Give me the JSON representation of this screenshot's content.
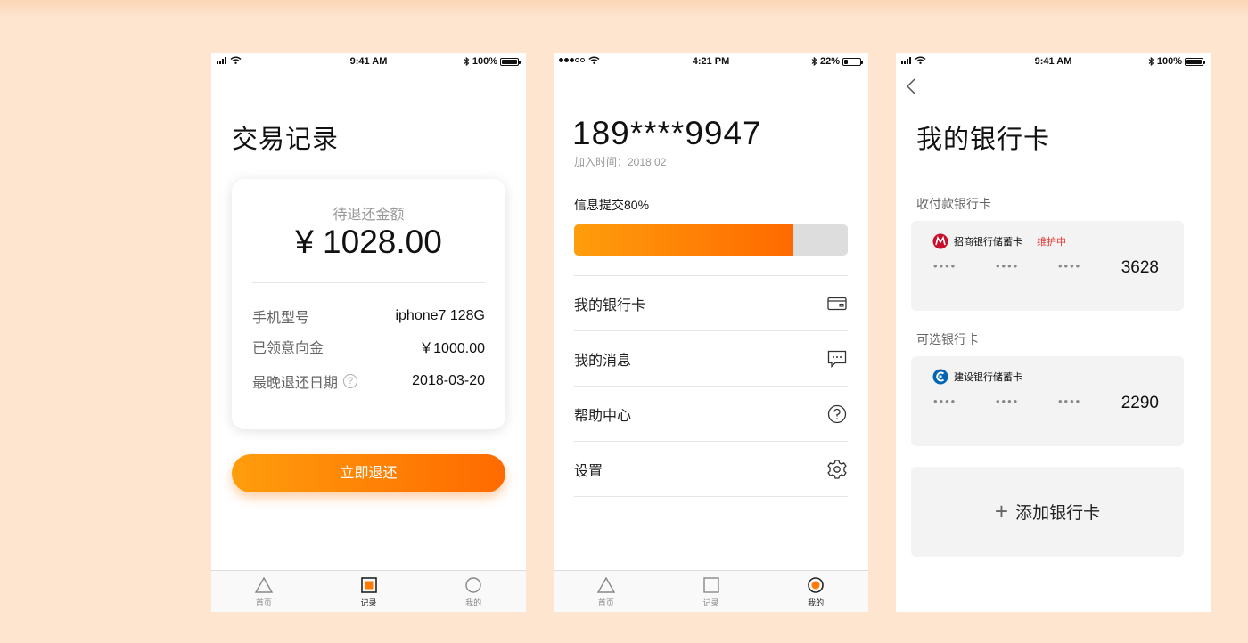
{
  "screen1": {
    "status": {
      "time": "9:41 AM",
      "battery": "100%",
      "battery_level": 1.0
    },
    "title": "交易记录",
    "card": {
      "caption": "待退还金额",
      "amount": "¥ 1028.00",
      "rows": [
        {
          "label": "手机型号",
          "value": "iphone7 128G"
        },
        {
          "label": "已领意向金",
          "value": "￥1000.00"
        },
        {
          "label": "最晚退还日期",
          "value": "2018-03-20",
          "help_icon": "question-circle-icon"
        }
      ]
    },
    "button": "立即退还",
    "tabs": [
      {
        "label": "首页",
        "icon": "triangle-icon",
        "active": false
      },
      {
        "label": "记录",
        "icon": "square-icon",
        "active": true
      },
      {
        "label": "我的",
        "icon": "circle-icon",
        "active": false
      }
    ]
  },
  "screen2": {
    "status": {
      "time": "4:21 PM",
      "battery": "22%",
      "battery_level": 0.22
    },
    "phone": "189****9947",
    "join_date": "加入时间：2018.02",
    "progress_label": "信息提交80%",
    "progress": 0.8,
    "menu": [
      {
        "label": "我的银行卡",
        "icon": "card-icon"
      },
      {
        "label": "我的消息",
        "icon": "message-icon"
      },
      {
        "label": "帮助中心",
        "icon": "help-icon"
      },
      {
        "label": "设置",
        "icon": "gear-icon"
      }
    ],
    "tabs": [
      {
        "label": "首页",
        "icon": "triangle-icon",
        "active": false
      },
      {
        "label": "记录",
        "icon": "square-icon",
        "active": false
      },
      {
        "label": "我的",
        "icon": "circle-icon",
        "active": true
      }
    ]
  },
  "screen3": {
    "status": {
      "time": "9:41 AM",
      "battery": "100%",
      "battery_level": 1.0
    },
    "title": "我的银行卡",
    "section_receive": "收付款银行卡",
    "section_optional": "可选银行卡",
    "cards": [
      {
        "bank": "招商银行储蓄卡",
        "badge": "维护中",
        "masks": [
          "••••",
          "••••",
          "••••"
        ],
        "last4": "3628",
        "brand_color": "#c8102e"
      },
      {
        "bank": "建设银行储蓄卡",
        "badge": "",
        "masks": [
          "••••",
          "••••",
          "••••"
        ],
        "last4": "2290",
        "brand_color": "#0066b3"
      }
    ],
    "add_label": "添加银行卡"
  },
  "colors": {
    "accent_start": "#ff9d0c",
    "accent_end": "#ff6a00",
    "background": "#fde5cf"
  }
}
